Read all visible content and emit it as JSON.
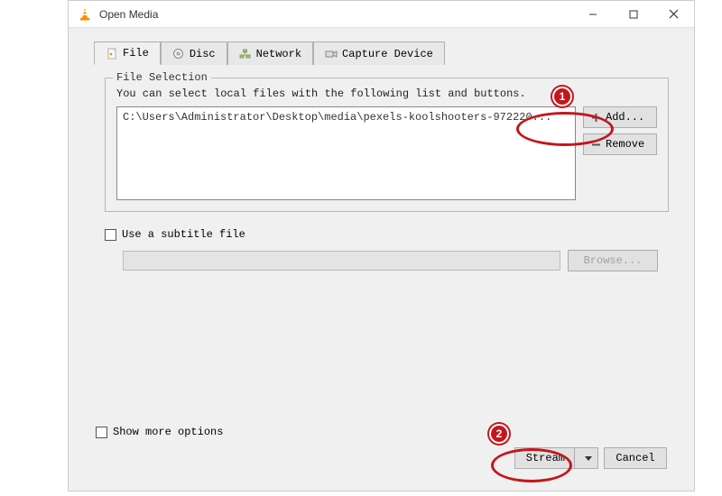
{
  "window": {
    "title": "Open Media"
  },
  "tabs": {
    "file": "File",
    "disc": "Disc",
    "network": "Network",
    "capture": "Capture Device"
  },
  "fileSelection": {
    "legend": "File Selection",
    "hint": "You can select local files with the following list and buttons.",
    "selectedFile": "C:\\Users\\Administrator\\Desktop\\media\\pexels-koolshooters-972220...",
    "addLabel": "Add...",
    "removeLabel": "Remove"
  },
  "subtitle": {
    "checkboxLabel": "Use a subtitle file",
    "browseLabel": "Browse..."
  },
  "footer": {
    "showMoreLabel": "Show more options",
    "streamLabel": "Stream",
    "cancelLabel": "Cancel"
  },
  "annotations": {
    "num1": "1",
    "num2": "2"
  }
}
